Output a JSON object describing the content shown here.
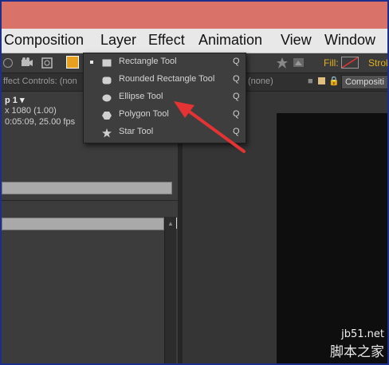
{
  "menubar": {
    "items": [
      "Composition",
      "Layer",
      "Effect",
      "Animation",
      "View",
      "Window"
    ]
  },
  "toolbar": {
    "fill_label": "Fill:",
    "stroke_label": "Strok"
  },
  "panel_tabs": {
    "effect_controls": "ffect Controls: (non",
    "none": "(none)",
    "composition": "Compositi"
  },
  "project_info": {
    "comp_name": "p 1 ▾",
    "resolution": "x 1080 (1.00)",
    "duration": "0:05:09, 25.00 fps"
  },
  "shape_menu": {
    "items": [
      {
        "label": "Rectangle Tool",
        "shortcut": "Q",
        "icon": "rectangle-icon",
        "active": true
      },
      {
        "label": "Rounded Rectangle Tool",
        "shortcut": "Q",
        "icon": "rounded-rectangle-icon",
        "active": false
      },
      {
        "label": "Ellipse Tool",
        "shortcut": "Q",
        "icon": "ellipse-icon",
        "active": false
      },
      {
        "label": "Polygon Tool",
        "shortcut": "Q",
        "icon": "polygon-icon",
        "active": false
      },
      {
        "label": "Star Tool",
        "shortcut": "Q",
        "icon": "star-icon",
        "active": false
      }
    ]
  },
  "watermark": {
    "line1": "jb51.net",
    "line2": "脚本之家"
  },
  "colors": {
    "title_strip": "#d9736a",
    "arrow": "#e53333",
    "frame_border": "#1c2f8a"
  }
}
